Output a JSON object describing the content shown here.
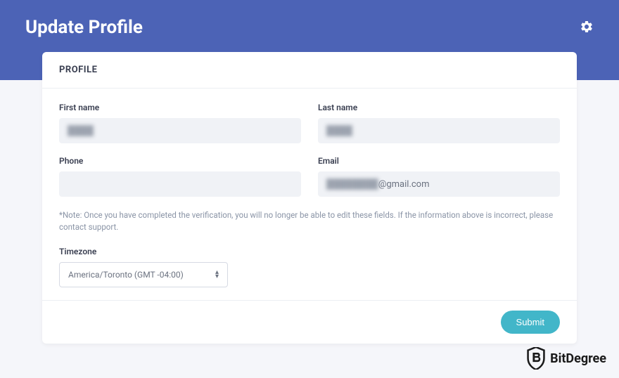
{
  "header": {
    "title": "Update Profile"
  },
  "card": {
    "title": "PROFILE"
  },
  "form": {
    "first_name": {
      "label": "First name",
      "value": "████"
    },
    "last_name": {
      "label": "Last name",
      "value": "████"
    },
    "phone": {
      "label": "Phone",
      "value": ""
    },
    "email": {
      "label": "Email",
      "blurred_prefix": "████████",
      "suffix": "@gmail.com"
    },
    "note": "*Note: Once you have completed the verification, you will no longer be able to edit these fields. If the information above is incorrect, please contact support.",
    "timezone": {
      "label": "Timezone",
      "value": "America/Toronto (GMT -04:00)"
    },
    "submit_label": "Submit"
  },
  "watermark": {
    "text": "BitDegree"
  }
}
